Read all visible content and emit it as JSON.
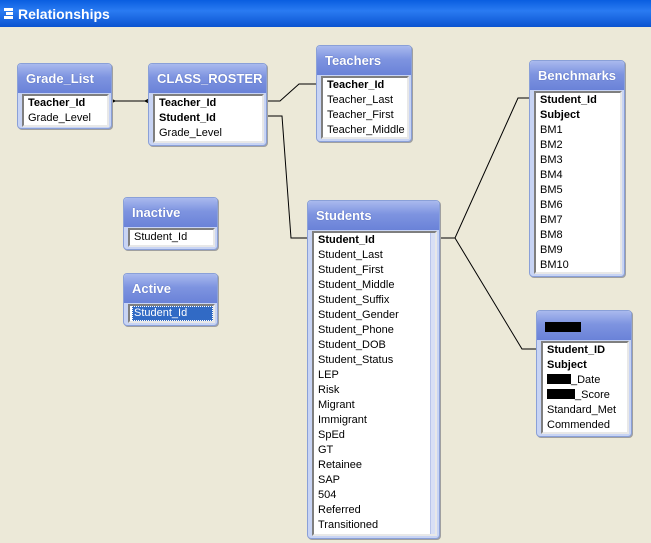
{
  "window": {
    "title": "Relationships"
  },
  "tables": {
    "grade_list": {
      "title": "Grade_List",
      "fields": [
        {
          "label": "Teacher_Id",
          "key": true
        },
        {
          "label": "Grade_Level",
          "key": false
        }
      ]
    },
    "class_roster": {
      "title": "CLASS_ROSTER",
      "fields": [
        {
          "label": "Teacher_Id",
          "key": true
        },
        {
          "label": "Student_Id",
          "key": true
        },
        {
          "label": "Grade_Level",
          "key": false
        }
      ]
    },
    "teachers": {
      "title": "Teachers",
      "fields": [
        {
          "label": "Teacher_Id",
          "key": true
        },
        {
          "label": "Teacher_Last",
          "key": false
        },
        {
          "label": "Teacher_First",
          "key": false
        },
        {
          "label": "Teacher_Middle",
          "key": false
        }
      ]
    },
    "benchmarks": {
      "title": "Benchmarks",
      "fields": [
        {
          "label": "Student_Id",
          "key": true
        },
        {
          "label": "Subject",
          "key": true
        },
        {
          "label": "BM1",
          "key": false
        },
        {
          "label": "BM2",
          "key": false
        },
        {
          "label": "BM3",
          "key": false
        },
        {
          "label": "BM4",
          "key": false
        },
        {
          "label": "BM5",
          "key": false
        },
        {
          "label": "BM6",
          "key": false
        },
        {
          "label": "BM7",
          "key": false
        },
        {
          "label": "BM8",
          "key": false
        },
        {
          "label": "BM9",
          "key": false
        },
        {
          "label": "BM10",
          "key": false
        }
      ]
    },
    "inactive": {
      "title": "Inactive",
      "fields": [
        {
          "label": "Student_Id",
          "key": false
        }
      ]
    },
    "active": {
      "title": "Active",
      "fields": [
        {
          "label": "Student_Id",
          "key": false,
          "selected": true
        }
      ]
    },
    "students": {
      "title": "Students",
      "fields": [
        {
          "label": "Student_Id",
          "key": true
        },
        {
          "label": "Student_Last",
          "key": false
        },
        {
          "label": "Student_First",
          "key": false
        },
        {
          "label": "Student_Middle",
          "key": false
        },
        {
          "label": "Student_Suffix",
          "key": false
        },
        {
          "label": "Student_Gender",
          "key": false
        },
        {
          "label": "Student_Phone",
          "key": false
        },
        {
          "label": "Student_DOB",
          "key": false
        },
        {
          "label": "Student_Status",
          "key": false
        },
        {
          "label": "LEP",
          "key": false
        },
        {
          "label": "Risk",
          "key": false
        },
        {
          "label": "Migrant",
          "key": false
        },
        {
          "label": "Immigrant",
          "key": false
        },
        {
          "label": "SpEd",
          "key": false
        },
        {
          "label": "GT",
          "key": false
        },
        {
          "label": "Retainee",
          "key": false
        },
        {
          "label": "SAP",
          "key": false
        },
        {
          "label": "504",
          "key": false
        },
        {
          "label": "Referred",
          "key": false
        },
        {
          "label": "Transitioned",
          "key": false
        }
      ]
    },
    "scores": {
      "title": "",
      "fields": [
        {
          "label": "Student_ID",
          "key": true
        },
        {
          "label": "Subject",
          "key": true
        },
        {
          "label": "_Date",
          "key": false,
          "redacted": true
        },
        {
          "label": "_Score",
          "key": false,
          "redacted": true
        },
        {
          "label": "Standard_Met",
          "key": false
        },
        {
          "label": "Commended",
          "key": false
        }
      ]
    }
  }
}
